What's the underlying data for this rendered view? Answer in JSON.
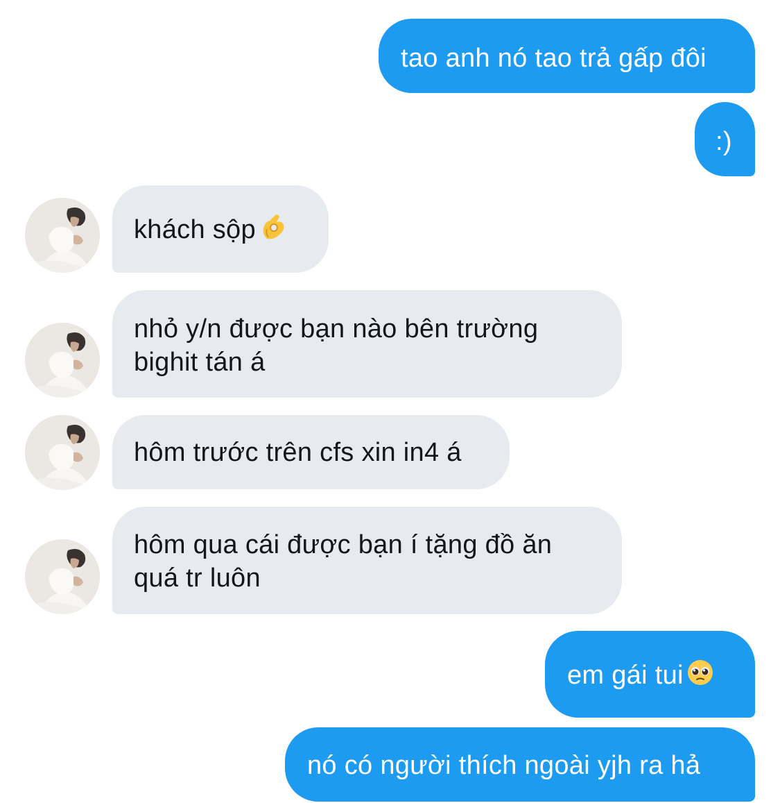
{
  "conversation": {
    "messages": [
      {
        "direction": "sent",
        "text": "tao anh nó tao trả gấp đôi"
      },
      {
        "direction": "sent",
        "text": ":)"
      },
      {
        "direction": "received",
        "text": "khách sộp",
        "emoji": "ok-hand-icon"
      },
      {
        "direction": "received",
        "lines": [
          "nhỏ y/n được bạn nào bên trường",
          "bighit tán á"
        ]
      },
      {
        "direction": "received",
        "text": "hôm trước trên cfs xin in4 á"
      },
      {
        "direction": "received",
        "lines": [
          "hôm qua cái được bạn í tặng đồ ăn",
          "quá tr luôn"
        ]
      },
      {
        "direction": "sent",
        "text": "em gái tui",
        "emoji": "pleading-face-icon"
      },
      {
        "direction": "sent",
        "text": "nó có người thích ngoài yjh ra hả"
      }
    ]
  },
  "colors": {
    "sent_bubble": "#1d9bf0",
    "received_bubble": "#e7ebef",
    "received_text": "#14171a",
    "background": "#ffffff"
  }
}
